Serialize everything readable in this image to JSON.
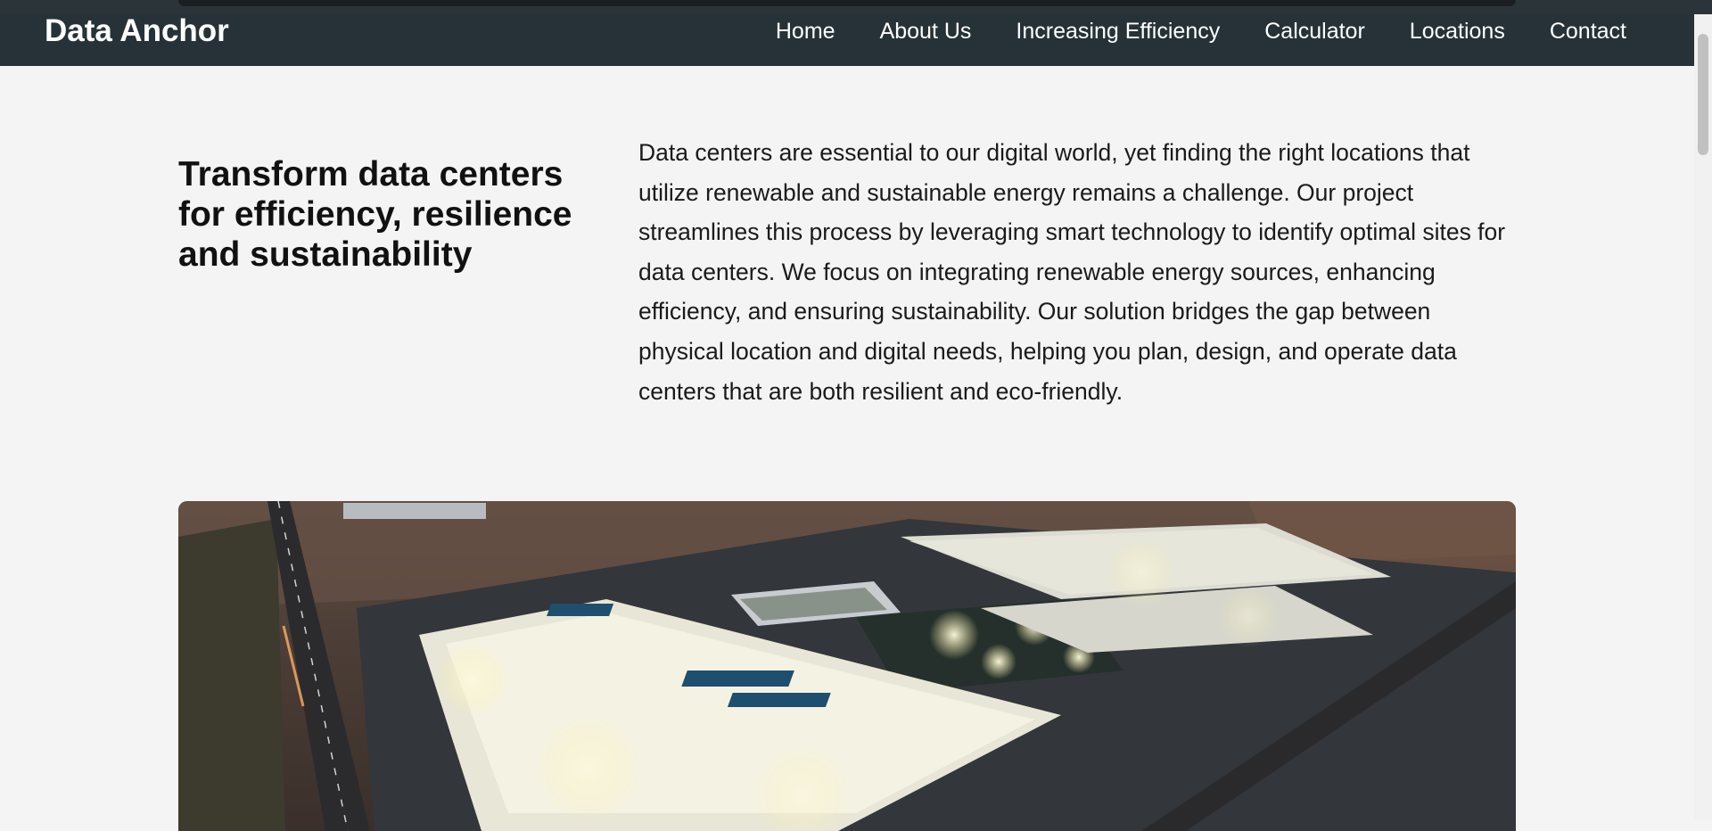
{
  "brand": {
    "name": "Data Anchor"
  },
  "nav": {
    "items": [
      {
        "label": "Home"
      },
      {
        "label": "About Us"
      },
      {
        "label": "Increasing Efficiency"
      },
      {
        "label": "Calculator"
      },
      {
        "label": "Locations"
      },
      {
        "label": "Contact"
      }
    ]
  },
  "hero": {
    "title": "Transform data centers for efficiency, resilience and sustainability",
    "description": "Data centers are essential to our digital world, yet finding the right locations that utilize renewable and sustainable energy remains a challenge. Our project streamlines this process by leveraging smart technology to identify optimal sites for data centers. We focus on integrating renewable energy sources, enhancing efficiency, and ensuring sustainability. Our solution bridges the gap between physical location and digital needs, helping you plan, design, and operate data centers that are both resilient and eco-friendly."
  },
  "colors": {
    "navbar": "#263238",
    "page_background": "#f4f4f4",
    "text": "#111111"
  }
}
